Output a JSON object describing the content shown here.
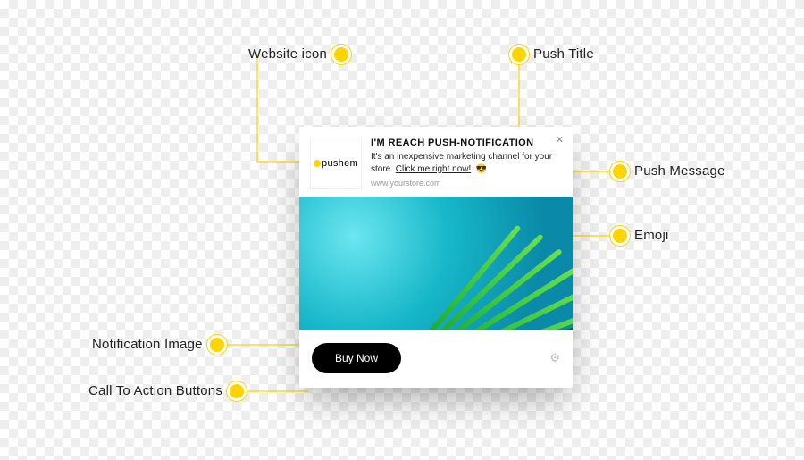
{
  "annotations": {
    "website_icon": "Website icon",
    "push_title": "Push Title",
    "push_message": "Push Message",
    "emoji": "Emoji",
    "notification_image": "Notification Image",
    "cta_buttons": "Call To Action Buttons"
  },
  "notification": {
    "brand": "pushem",
    "title": "I'M REACH PUSH-NOTIFICATION",
    "message_pre": "It's an inexpensive marketing channel for your store. ",
    "message_link": "Click me right now!",
    "emoji": "😎",
    "site": "www.yourstore.com",
    "buy_label": "Buy Now"
  }
}
